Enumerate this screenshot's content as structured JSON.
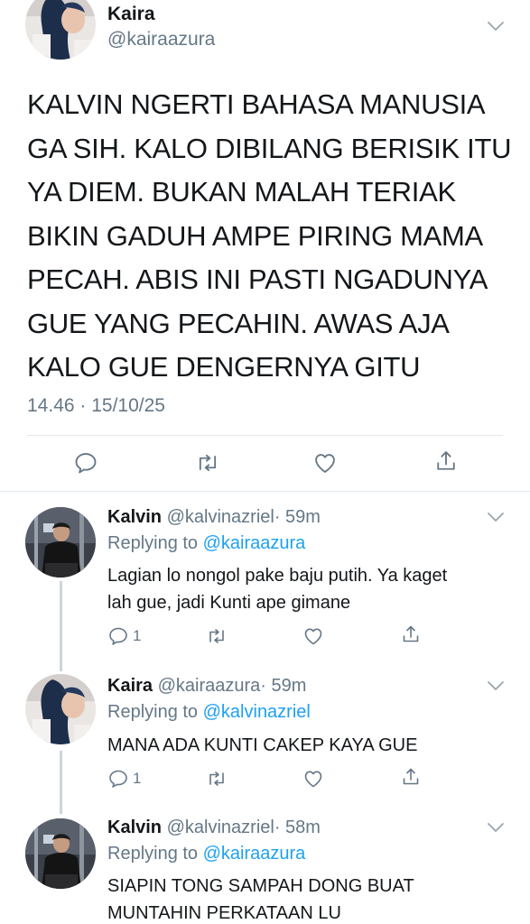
{
  "main_tweet": {
    "name": "Kaira",
    "handle": "@kairaazura",
    "text_lines": [
      "KALVIN NGERTI BAHASA MANUSIA",
      "GA SIH. KALO DIBILANG BERISIK ITU",
      "YA DIEM. BUKAN MALAH TERIAK",
      "BIKIN GADUH AMPE PIRING MAMA",
      "PECAH. ABIS INI PASTI NGADUNYA",
      "GUE YANG PECAHIN. AWAS AJA",
      "KALO GUE DENGERNYA GITU"
    ],
    "timestamp": "14.46 · 15/10/25",
    "icons": [
      "reply-icon",
      "retweet-icon",
      "like-icon",
      "share-icon"
    ]
  },
  "replies": [
    {
      "name": "Kalvin",
      "handle": "@kalvinazriel",
      "time": "· 59m",
      "replying_prefix": "Replying to",
      "replying_to": "@kairaazura",
      "text_lines": [
        "Lagian lo nongol pake baju putih. Ya kaget",
        "lah gue, jadi Kunti ape gimane"
      ],
      "reply_count": "1"
    },
    {
      "name": "Kaira",
      "handle": "@kairaazura",
      "time": "· 59m",
      "replying_prefix": "Replying to",
      "replying_to": "@kalvinazriel",
      "text_lines": [
        "MANA ADA KUNTI CAKEP KAYA GUE"
      ],
      "reply_count": "1"
    },
    {
      "name": "Kalvin",
      "handle": "@kalvinazriel",
      "time": "· 58m",
      "replying_prefix": "Replying to",
      "replying_to": "@kairaazura",
      "text_lines": [
        "SIAPIN TONG SAMPAH DONG BUAT",
        "MUNTAHIN PERKATAAN LU"
      ]
    }
  ],
  "colors": {
    "text": "#14171a",
    "secondary": "#657786",
    "link": "#1da1f2",
    "divider": "#e1e8ed",
    "thread_line": "#ccd6dd"
  }
}
